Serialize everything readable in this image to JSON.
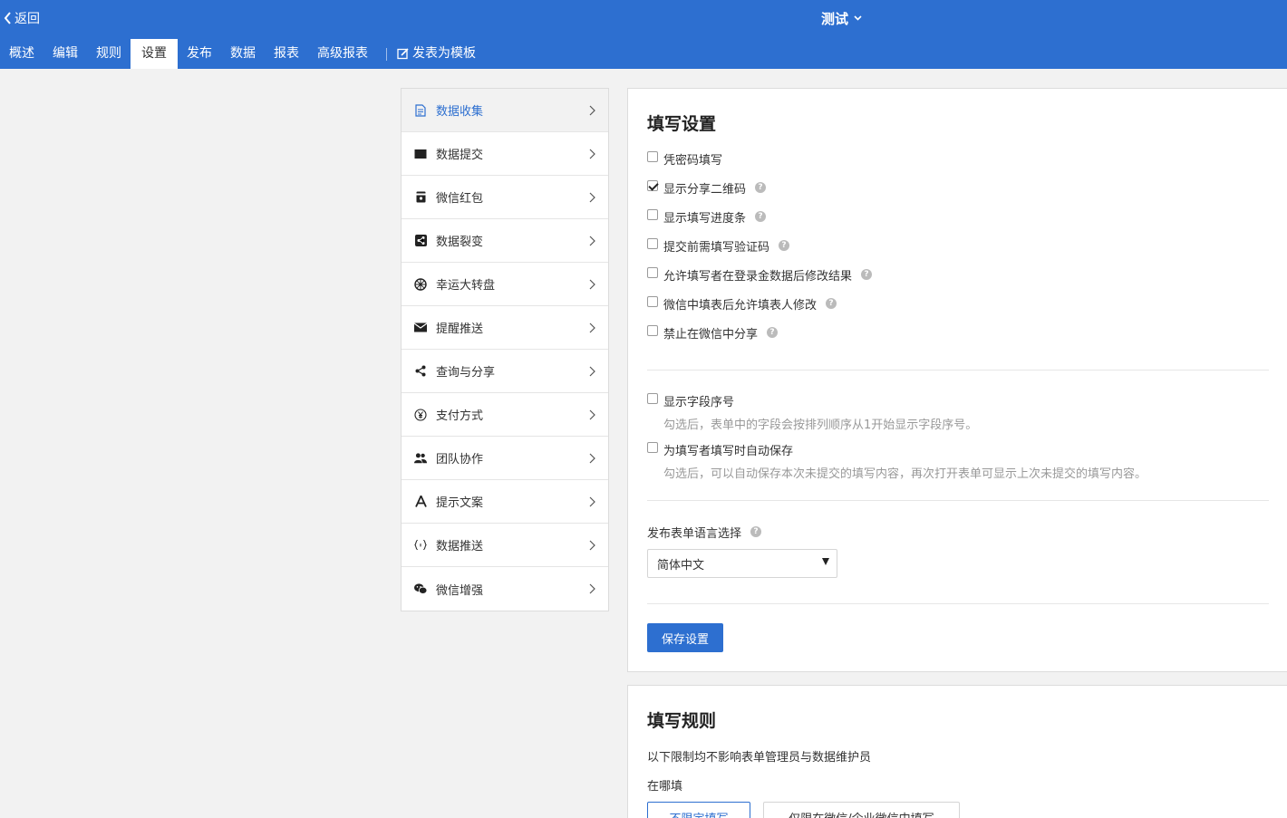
{
  "header": {
    "back_label": "返回",
    "form_title": "测试",
    "tabs": [
      "概述",
      "编辑",
      "规则",
      "设置",
      "发布",
      "数据",
      "报表",
      "高级报表"
    ],
    "active_tab": "设置",
    "template_label": "发表为模板"
  },
  "menu": {
    "items": [
      {
        "label": "数据收集",
        "icon": "document-icon"
      },
      {
        "label": "数据提交",
        "icon": "square-icon"
      },
      {
        "label": "微信红包",
        "icon": "red-packet-icon"
      },
      {
        "label": "数据裂变",
        "icon": "share-square-icon"
      },
      {
        "label": "幸运大转盘",
        "icon": "wheel-icon"
      },
      {
        "label": "提醒推送",
        "icon": "envelope-icon"
      },
      {
        "label": "查询与分享",
        "icon": "share-icon"
      },
      {
        "label": "支付方式",
        "icon": "yen-icon"
      },
      {
        "label": "团队协作",
        "icon": "team-icon"
      },
      {
        "label": "提示文案",
        "icon": "font-icon"
      },
      {
        "label": "数据推送",
        "icon": "code-icon"
      },
      {
        "label": "微信增强",
        "icon": "wechat-icon"
      }
    ],
    "active": "数据收集"
  },
  "fill_settings": {
    "title": "填写设置",
    "options": [
      {
        "label": "凭密码填写",
        "checked": false,
        "help": false
      },
      {
        "label": "显示分享二维码",
        "checked": true,
        "help": true
      },
      {
        "label": "显示填写进度条",
        "checked": false,
        "help": true
      },
      {
        "label": "提交前需填写验证码",
        "checked": false,
        "help": true
      },
      {
        "label": "允许填写者在登录金数据后修改结果",
        "checked": false,
        "help": true
      },
      {
        "label": "微信中填表后允许填表人修改",
        "checked": false,
        "help": true
      },
      {
        "label": "禁止在微信中分享",
        "checked": false,
        "help": true
      }
    ],
    "field_number": {
      "label": "显示字段序号",
      "checked": false,
      "desc": "勾选后，表单中的字段会按排列顺序从1开始显示字段序号。"
    },
    "auto_save": {
      "label": "为填写者填写时自动保存",
      "checked": false,
      "desc": "勾选后，可以自动保存本次未提交的填写内容，再次打开表单可显示上次未提交的填写内容。"
    },
    "language_label": "发布表单语言选择",
    "language_value": "简体中文",
    "save_label": "保存设置"
  },
  "fill_rules": {
    "title": "填写规则",
    "note": "以下限制均不影响表单管理员与数据维护员",
    "where_label": "在哪填",
    "option1": "不限定填写",
    "option2": "仅限在微信/企业微信中填写"
  },
  "colors": {
    "brand": "#2d6fd0"
  }
}
